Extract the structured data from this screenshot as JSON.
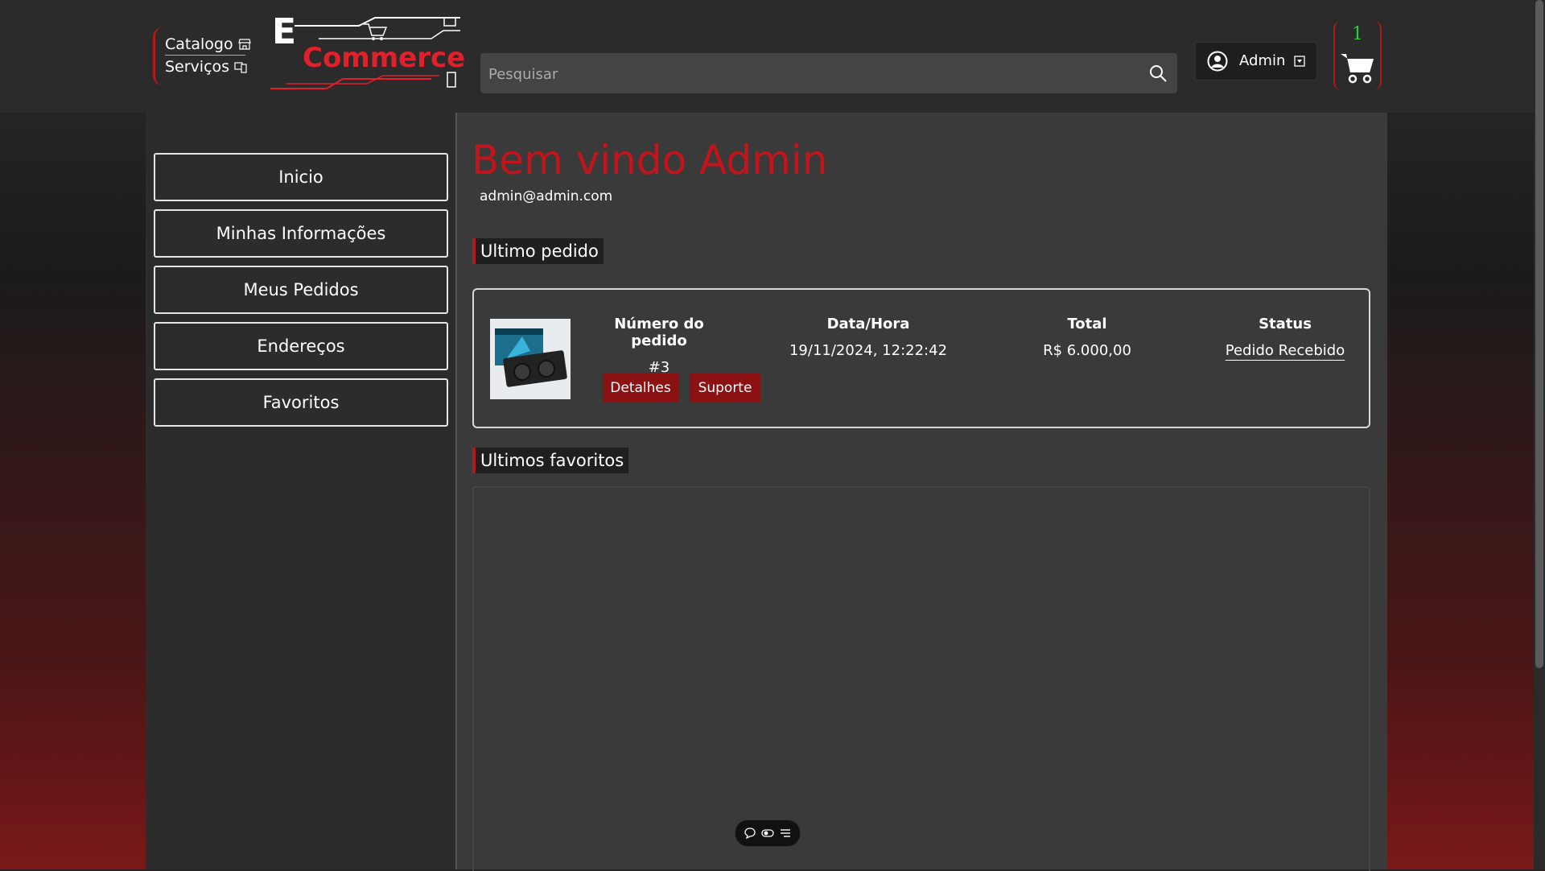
{
  "header": {
    "nav": [
      {
        "label": "Catalogo",
        "icon": "store-icon"
      },
      {
        "label": "Serviços",
        "icon": "devices-icon"
      }
    ],
    "logo": {
      "prefix": "E",
      "word": "Commerce"
    },
    "search": {
      "placeholder": "Pesquisar",
      "value": ""
    },
    "user": {
      "name": "Admin"
    },
    "cart": {
      "count": "1"
    }
  },
  "sidebar": {
    "items": [
      {
        "label": "Inicio"
      },
      {
        "label": "Minhas Informações"
      },
      {
        "label": "Meus Pedidos"
      },
      {
        "label": "Endereços"
      },
      {
        "label": "Favoritos"
      }
    ]
  },
  "main": {
    "welcome": "Bem vindo Admin",
    "email": "admin@admin.com",
    "last_order_title": "Ultimo pedido",
    "order": {
      "number_header": "Número do pedido",
      "number": "#3",
      "date_header": "Data/Hora",
      "date": "19/11/2024, 12:22:42",
      "total_header": "Total",
      "total": "R$ 6.000,00",
      "status_header": "Status",
      "status": "Pedido Recebido",
      "details_label": "Detalhes",
      "support_label": "Suporte"
    },
    "favorites_title": "Ultimos favoritos"
  },
  "colors": {
    "accent": "#c4141b",
    "status_ok": "#2ea043",
    "cart_count": "#2ecc40"
  }
}
